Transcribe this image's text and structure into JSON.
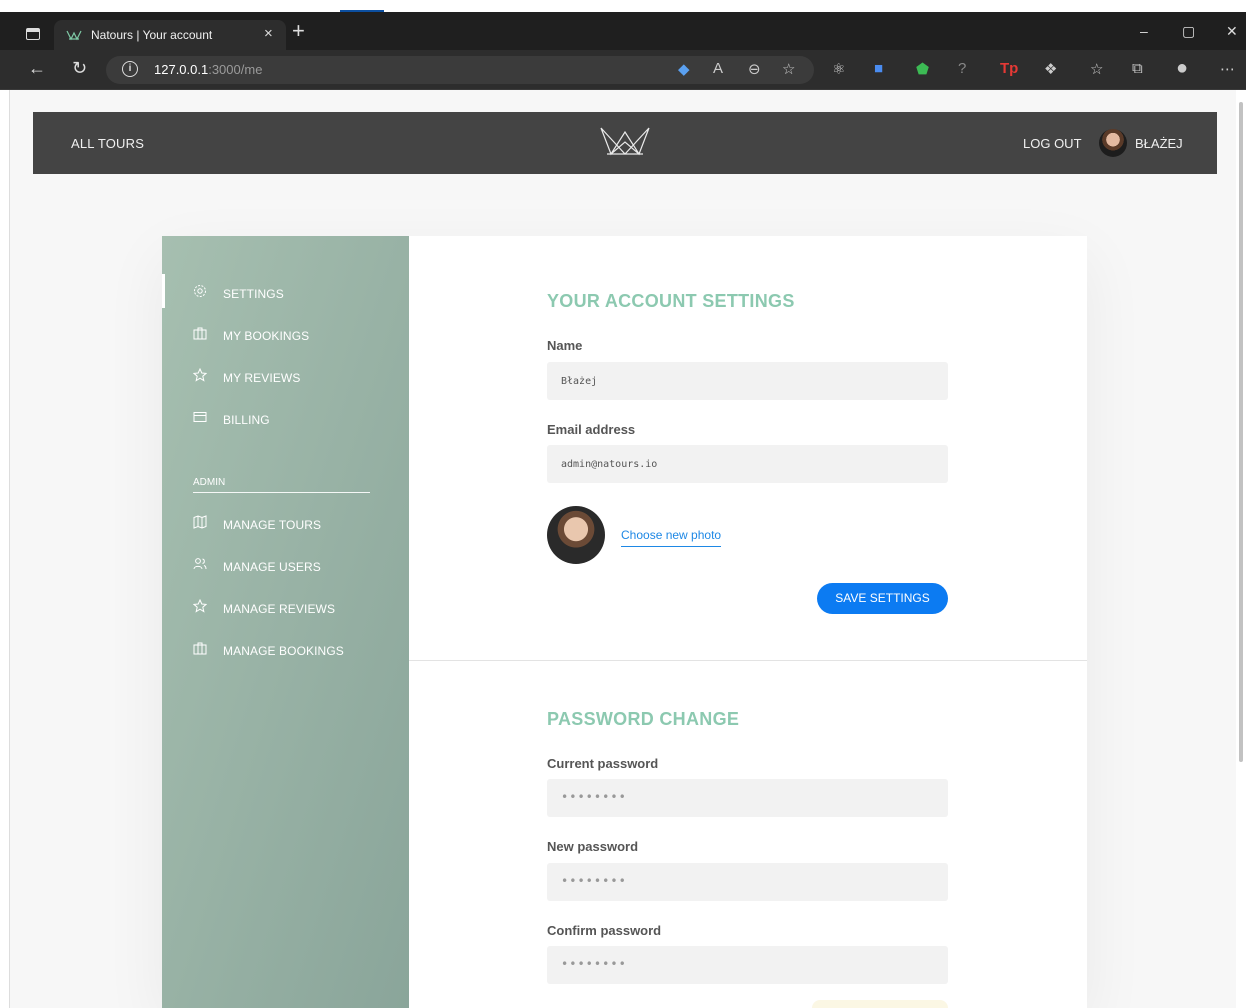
{
  "browser": {
    "tab_title": "Natours | Your account",
    "tab_close": "×",
    "new_tab": "+",
    "url_host": "127.0.0.1",
    "url_path": ":3000/me",
    "window_controls": [
      "–",
      "▢",
      "✕"
    ]
  },
  "header": {
    "all_tours": "ALL TOURS",
    "log_out": "LOG OUT",
    "user_name": "BŁAŻEJ"
  },
  "sidebar": {
    "items": [
      {
        "label": "SETTINGS",
        "icon": "settings-icon"
      },
      {
        "label": "MY BOOKINGS",
        "icon": "briefcase-icon"
      },
      {
        "label": "MY REVIEWS",
        "icon": "star-icon"
      },
      {
        "label": "BILLING",
        "icon": "credit-card-icon"
      }
    ],
    "admin_heading": "ADMIN",
    "admin_items": [
      {
        "label": "MANAGE TOURS",
        "icon": "map-icon"
      },
      {
        "label": "MANAGE USERS",
        "icon": "users-icon"
      },
      {
        "label": "MANAGE REVIEWS",
        "icon": "star-icon"
      },
      {
        "label": "MANAGE BOOKINGS",
        "icon": "briefcase-icon"
      }
    ]
  },
  "account": {
    "title": "YOUR ACCOUNT SETTINGS",
    "name_label": "Name",
    "name_value": "Błażej",
    "email_label": "Email address",
    "email_value": "admin@natours.io",
    "choose_photo": "Choose new photo",
    "save_button": "SAVE SETTINGS"
  },
  "password": {
    "title": "PASSWORD CHANGE",
    "current_label": "Current password",
    "new_label": "New password",
    "confirm_label": "Confirm password",
    "mask": "••••••••"
  },
  "colors": {
    "accent_green": "#8cc9b0",
    "button_blue": "#0c7bf2",
    "header_bg": "#444444"
  }
}
